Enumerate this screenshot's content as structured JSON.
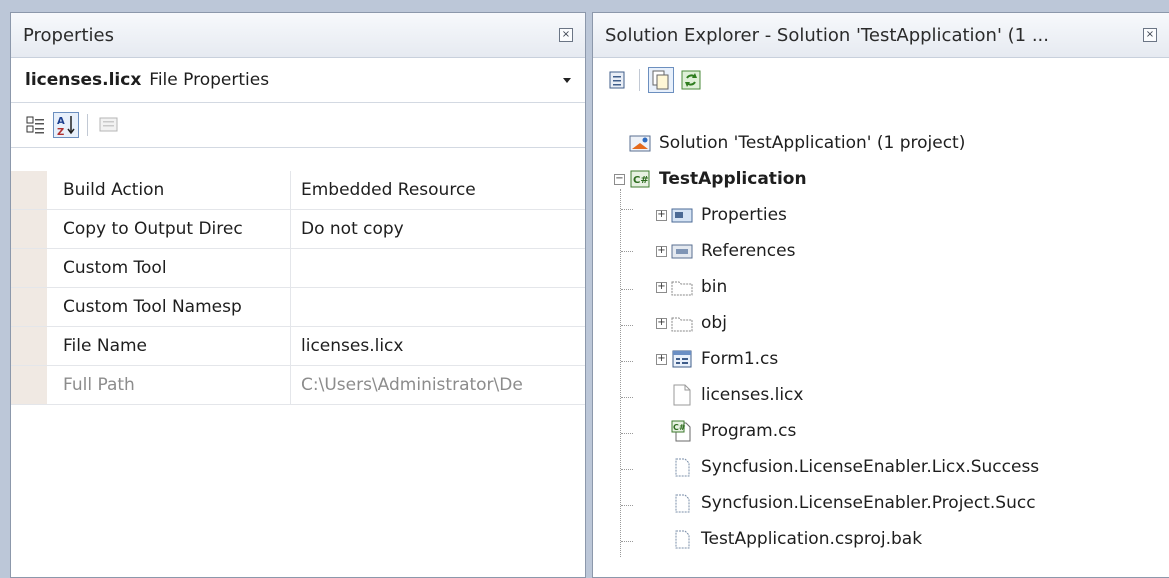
{
  "properties": {
    "title": "Properties",
    "object_name": "licenses.licx",
    "object_type": "File Properties",
    "rows": [
      {
        "name": "Build Action",
        "value": "Embedded Resource"
      },
      {
        "name": "Copy to Output Direc",
        "value": "Do not copy"
      },
      {
        "name": "Custom Tool",
        "value": ""
      },
      {
        "name": "Custom Tool Namesp",
        "value": ""
      },
      {
        "name": "File Name",
        "value": "licenses.licx"
      },
      {
        "name": "Full Path",
        "value": "C:\\Users\\Administrator\\De"
      }
    ]
  },
  "solution": {
    "title": "Solution Explorer - Solution 'TestApplication' (1 ...",
    "root": "Solution 'TestApplication' (1 project)",
    "project": "TestApplication",
    "items": [
      "Properties",
      "References",
      "bin",
      "obj",
      "Form1.cs",
      "licenses.licx",
      "Program.cs",
      "Syncfusion.LicenseEnabler.Licx.Success",
      "Syncfusion.LicenseEnabler.Project.Succ",
      "TestApplication.csproj.bak"
    ]
  },
  "colors": {
    "background": "#bcc7d8",
    "grid_gutter": "#f0e9e3"
  }
}
